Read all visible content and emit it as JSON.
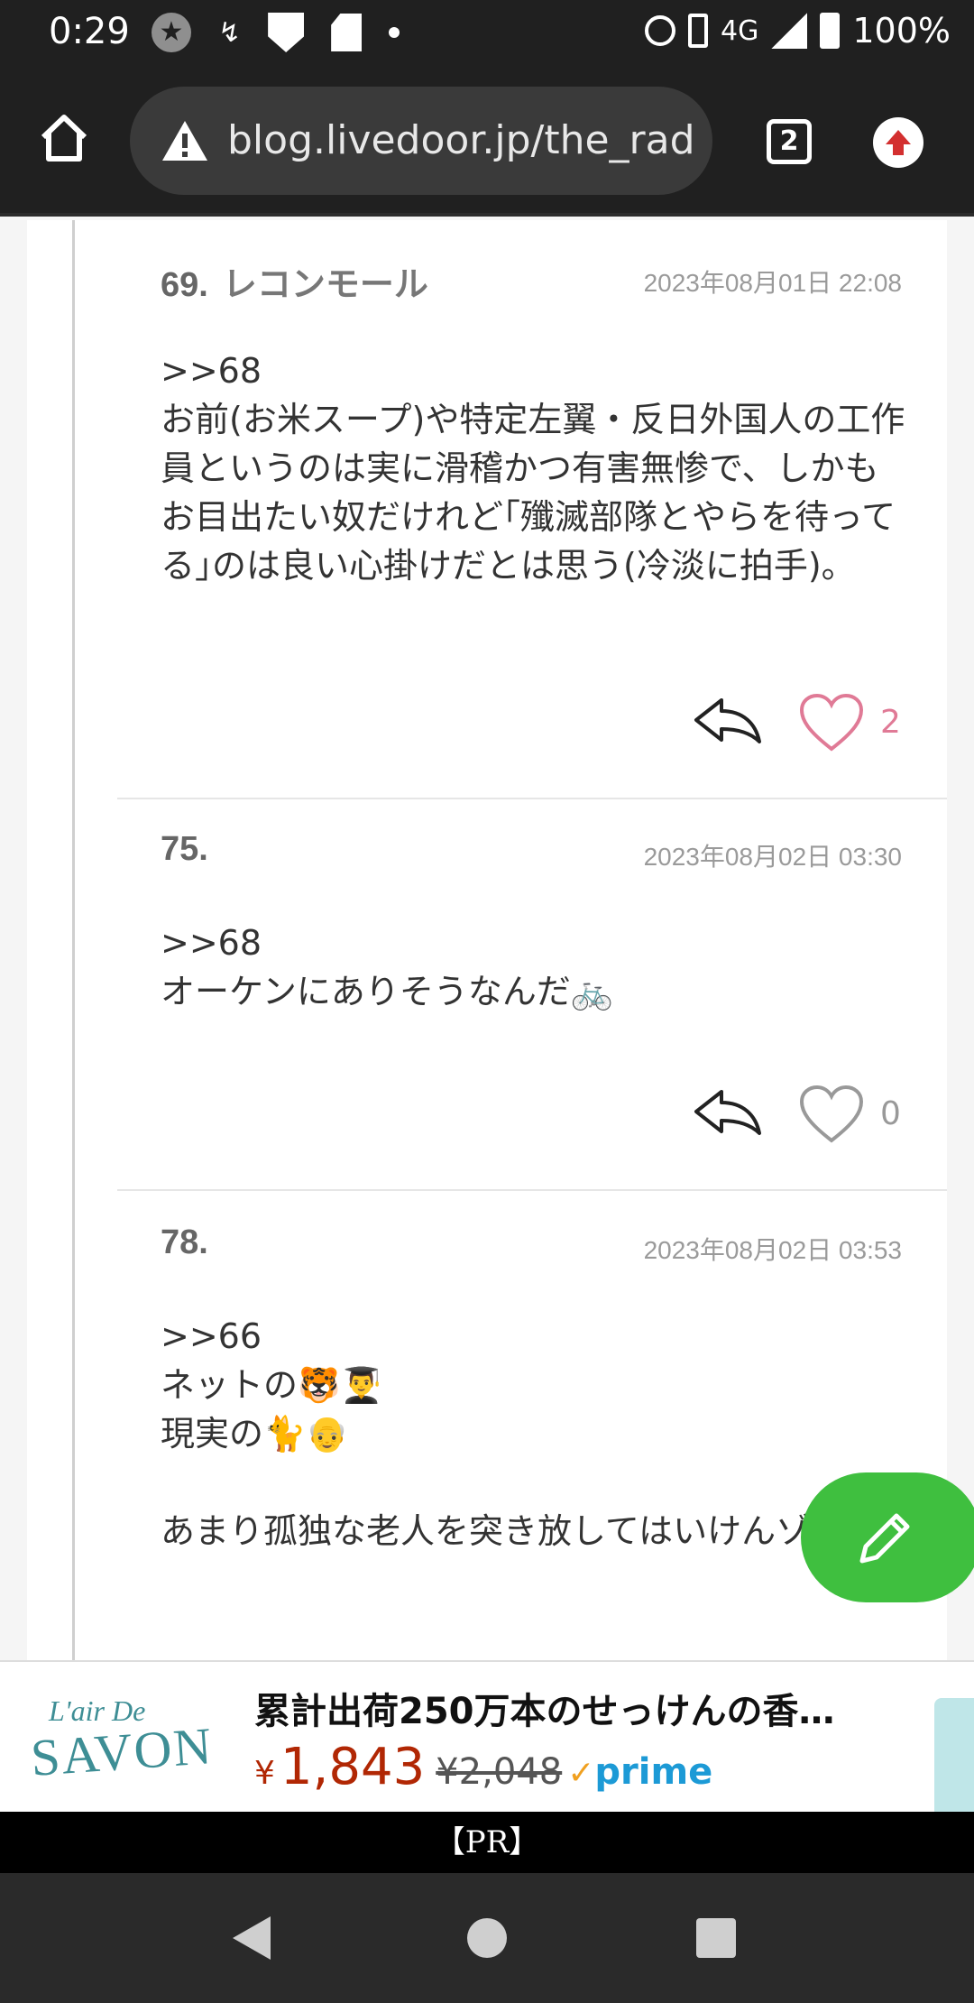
{
  "status_bar": {
    "time": "0:29",
    "network": "4G",
    "battery": "100%"
  },
  "browser": {
    "url": "blog.livedoor.jp/the_radi",
    "tab_count": "2"
  },
  "comments": [
    {
      "number": "69.",
      "name": "レコンモール",
      "date": "2023年08月01日 22:08",
      "body": ">>68\nお前(お米スープ)や特定左翼・反日外国人の工作員というのは実に滑稽かつ有害無惨で、しかもお目出たい奴だけれど｢殲滅部隊とやらを待ってる｣のは良い心掛けだとは思う(冷淡に拍手)。",
      "likes": "2",
      "liked": true
    },
    {
      "number": "75.",
      "name": "",
      "date": "2023年08月02日 03:30",
      "body": ">>68\nオーケンにありそうなんだ🚲",
      "likes": "0",
      "liked": false
    },
    {
      "number": "78.",
      "name": "",
      "date": "2023年08月02日 03:53",
      "body": ">>66\nネットの🐯👨‍🎓\n現実の🐈👴\n\nあまり孤独な老人を突き放してはいけんゾ",
      "likes": "",
      "liked": false
    }
  ],
  "ad": {
    "logo_line1": "L'air De",
    "logo_line2": "SAVON",
    "title": "累計出荷250万本のせっけんの香…",
    "currency": "¥",
    "price": "1,843",
    "old_price": "¥2,048",
    "prime_check": "✓",
    "prime": "prime",
    "pr_label": "【PR】"
  },
  "icons": {
    "home": "home-icon",
    "warning": "warning-icon",
    "update": "update-arrow-icon",
    "reply": "reply-icon",
    "heart": "heart-icon",
    "edit": "pencil-icon"
  },
  "colors": {
    "like_active": "#e07a96",
    "fab": "#3fbf3f",
    "price": "#b12704",
    "prime": "#1c9ad6"
  }
}
